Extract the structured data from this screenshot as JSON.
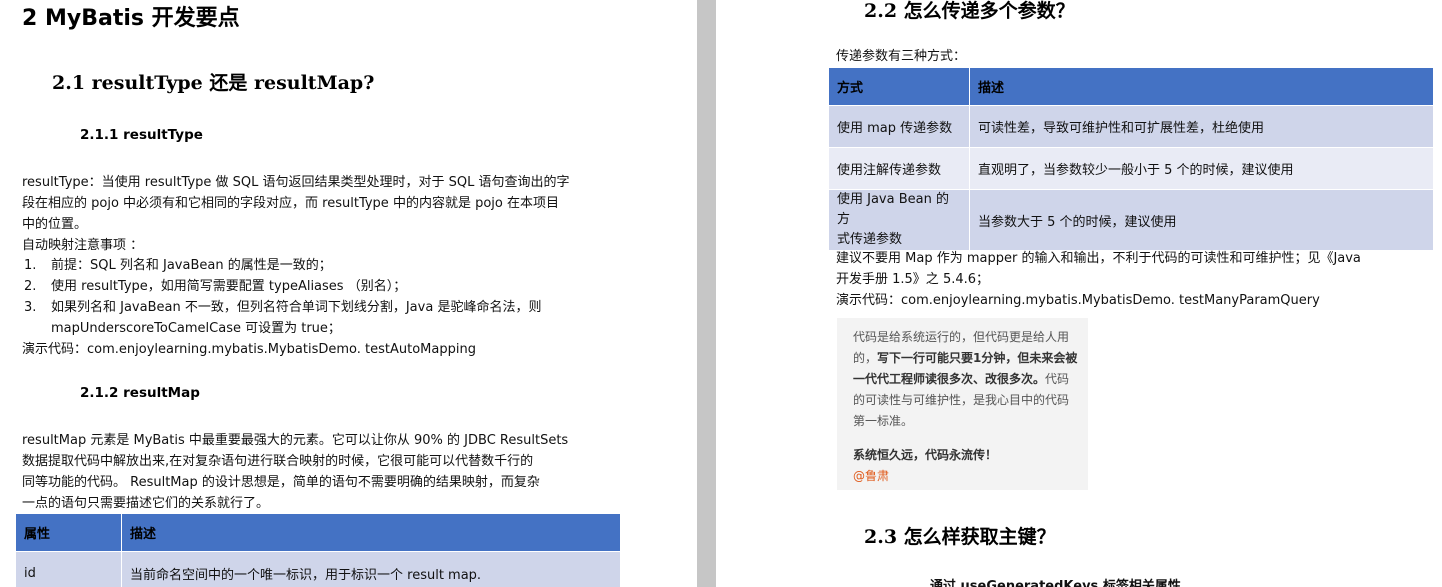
{
  "left": {
    "h1": "2   MyBatis 开发要点",
    "h2_1": "2.1  resultType 还是 resultMap?",
    "h3_1": "2.1.1 resultType",
    "para1": [
      "resultType：当使用 resultType 做 SQL 语句返回结果类型处理时，对于 SQL 语句查询出的字",
      "段在相应的 pojo 中必须有和它相同的字段对应，而 resultType 中的内容就是 pojo 在本项目",
      "中的位置。"
    ],
    "automap_title": "自动映射注意事项 ：",
    "list": [
      {
        "num": "1.",
        "lines": [
          "前提：SQL 列名和 JavaBean 的属性是一致的；"
        ]
      },
      {
        "num": "2.",
        "lines": [
          "使用 resultType，如用简写需要配置 typeAliases （别名）；"
        ]
      },
      {
        "num": "3.",
        "lines": [
          "如果列名和 JavaBean 不一致，但列名符合单词下划线分割，Java 是驼峰命名法，则",
          "mapUnderscoreToCamelCase 可设置为 true；"
        ]
      }
    ],
    "demo1": "演示代码：com.enjoylearning.mybatis.MybatisDemo. testAutoMapping",
    "h3_2": "2.1.2 resultMap",
    "para2": [
      "resultMap 元素是  MyBatis 中最重要最强大的元素。它可以让你从  90%  的 JDBC ResultSets",
      "数据提取代码中解放出来,在对复杂语句进行联合映射的时候，它很可能可以代替数千行的",
      "同等功能的代码。  ResultMap  的设计思想是，简单的语句不需要明确的结果映射，而复杂",
      "一点的语句只需要描述它们的关系就行了。"
    ],
    "table": {
      "headers": [
        "属性",
        "描述"
      ],
      "rows": [
        [
          "id",
          "当前命名空间中的一个唯一标识，用于标识一个 result map."
        ]
      ]
    }
  },
  "right": {
    "h2_2": "2.2  怎么传递多个参数？",
    "intro": "传递参数有三种方式：",
    "table": {
      "headers": [
        "方式",
        "描述"
      ],
      "rows": [
        [
          [
            "使用 map 传递参数"
          ],
          "可读性差，导致可维护性和可扩展性差，杜绝使用"
        ],
        [
          [
            "使用注解传递参数"
          ],
          "直观明了，当参数较少一般小于 5 个的时候，建议使用"
        ],
        [
          [
            "使用 Java Bean 的方",
            "式传递参数"
          ],
          "当参数大于 5 个的时候，建议使用"
        ]
      ]
    },
    "advice": [
      "建议不要用 Map 作为 mapper 的输入和输出，不利于代码的可读性和可维护性；见《Java",
      "开发手册 1.5》之 5.4.6；"
    ],
    "demo2": "演示代码：com.enjoylearning.mybatis.MybatisDemo. testManyParamQuery",
    "quote": {
      "line1": "代码是给系统运行的，但代码更是给人用",
      "line2_plain": "的，",
      "line2_bold": "写下一行可能只要1分钟，但未来会被",
      "line3_bold": "一代代工程师读很多次、改很多次。",
      "line3_plain": "代码",
      "line4": "的可读性与可维护性，是我心目中的代码",
      "line5": "第一标准。",
      "slogan": "系统恒久远，代码永流传！",
      "author": "@鲁肃"
    },
    "h2_3": "2.3  怎么样获取主键？",
    "next_partial": "通过 useGeneratedKeys 标签相关属性"
  }
}
